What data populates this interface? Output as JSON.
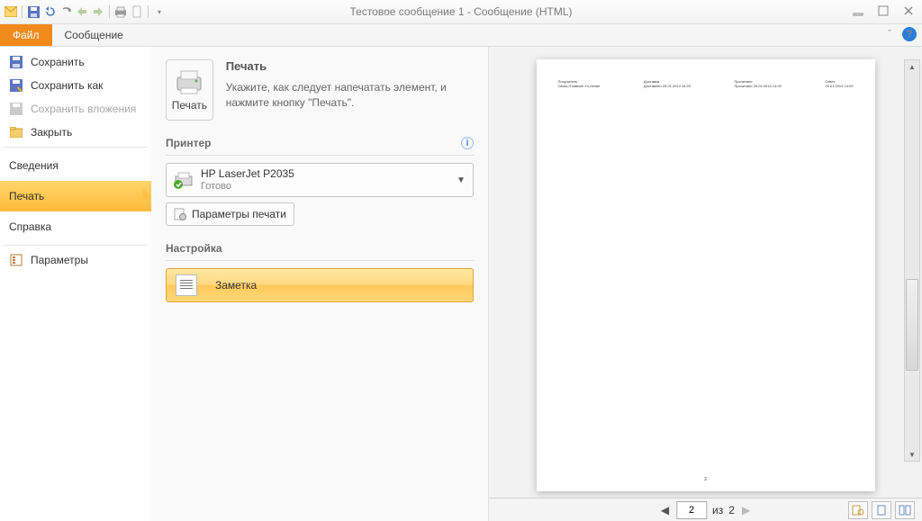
{
  "title": "Тестовое сообщение 1  -  Сообщение (HTML)",
  "ribbon": {
    "file": "Файл",
    "message": "Сообщение"
  },
  "backstage": {
    "save": "Сохранить",
    "save_as": "Сохранить как",
    "save_attachments": "Сохранить вложения",
    "close": "Закрыть",
    "info": "Сведения",
    "print": "Печать",
    "help": "Справка",
    "options": "Параметры"
  },
  "print": {
    "title": "Печать",
    "desc": "Укажите, как следует напечатать элемент, и нажмите кнопку \"Печать\".",
    "button": "Печать"
  },
  "printer": {
    "title": "Принтер",
    "name": "HP LaserJet P2035",
    "status": "Готово",
    "settings_btn": "Параметры печати"
  },
  "settings": {
    "title": "Настройка",
    "option": "Заметка"
  },
  "pager": {
    "current": "2",
    "of_label": "из",
    "total": "2"
  }
}
